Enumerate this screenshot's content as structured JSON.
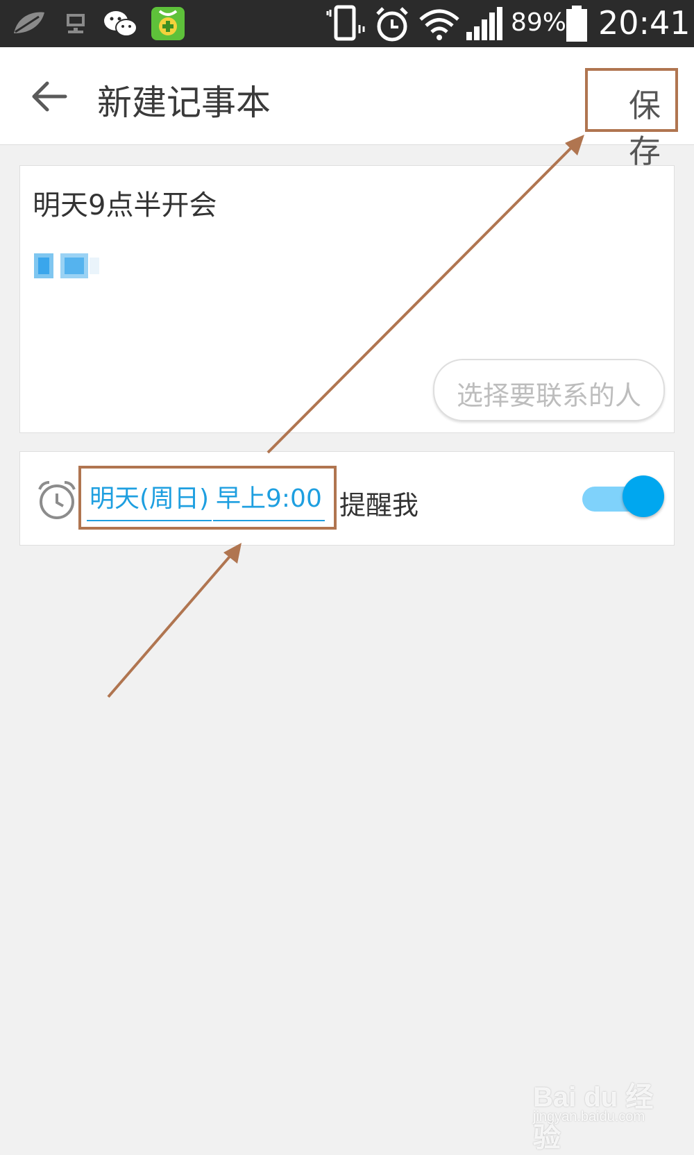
{
  "status_bar": {
    "notification_icons": [
      "leaf-icon",
      "desktop-icon",
      "wechat-icon",
      "security-app-icon"
    ],
    "system_icons": [
      "vibrate-icon",
      "alarm-icon",
      "wifi-icon",
      "signal-icon",
      "battery-icon"
    ],
    "battery": "89%",
    "time": "20:41"
  },
  "app_bar": {
    "back_icon": "arrow-left-icon",
    "title": "新建记事本",
    "save_label": "保存"
  },
  "note": {
    "title": "明天9点半开会",
    "contact_button": "选择要联系的人"
  },
  "reminder": {
    "icon": "alarm-clock-icon",
    "date": "明天(周日)",
    "time": "早上9:00",
    "suffix": "提醒我",
    "enabled": true
  },
  "watermark": {
    "text": "Bai du 经验",
    "url": "jingyan.baidu.com"
  },
  "colors": {
    "accent": "#1e9fe0",
    "toggle_thumb": "#00a7ef",
    "toggle_track": "#7fd2fb",
    "annotation": "#b07550",
    "background": "#f1f1f1"
  }
}
